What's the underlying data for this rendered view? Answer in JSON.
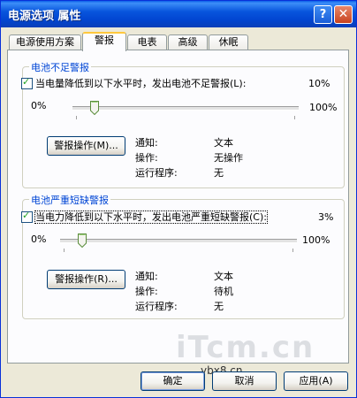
{
  "window": {
    "title": "电源选项 属性",
    "help_label": "?",
    "close_label": "✕"
  },
  "tabs": [
    {
      "label": "电源使用方案",
      "active": false
    },
    {
      "label": "警报",
      "active": true
    },
    {
      "label": "电表",
      "active": false
    },
    {
      "label": "高级",
      "active": false
    },
    {
      "label": "休眠",
      "active": false
    }
  ],
  "low_battery": {
    "group_title": "电池不足警报",
    "checkbox_label": "当电量降低到以下水平时，发出电池不足警报(L):",
    "checked": true,
    "percent_text": "10%",
    "level": 10,
    "min_label": "0%",
    "max_label": "100%",
    "action_button": "警报操作(M)...",
    "info": {
      "notify_label": "通知:",
      "notify_value": "文本",
      "action_label": "操作:",
      "action_value": "无操作",
      "program_label": "运行程序:",
      "program_value": "无"
    }
  },
  "critical_battery": {
    "group_title": "电池严重短缺警报",
    "checkbox_label": "当电力降低到以下水平时，发出电池严重短缺警报(C):",
    "checked": true,
    "percent_text": "3%",
    "level": 3,
    "min_label": "0%",
    "max_label": "100%",
    "action_button": "警报操作(R)...",
    "info": {
      "notify_label": "通知:",
      "notify_value": "文本",
      "action_label": "操作:",
      "action_value": "待机",
      "program_label": "运行程序:",
      "program_value": "无"
    }
  },
  "buttons": {
    "ok": "确定",
    "cancel": "取消",
    "apply": "应用(A)"
  },
  "watermark": {
    "logo": "iTcm.cn",
    "site": "ybx8.cn"
  }
}
